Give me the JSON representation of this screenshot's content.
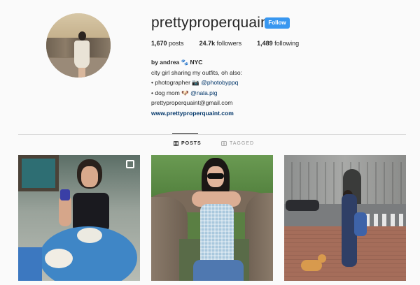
{
  "profile": {
    "username": "prettyproperquaint",
    "follow_label": "Follow",
    "stats": {
      "posts_count": "1,670",
      "posts_label": "posts",
      "followers_count": "24.7k",
      "followers_label": "followers",
      "following_count": "1,489",
      "following_label": "following"
    },
    "bio": {
      "name_line": "by andrea 🐾 NYC",
      "line1": "city girl sharing my outfits, oh also:",
      "line2_prefix": "• photographer 📷",
      "line2_handle": "@photobyppq",
      "line3_prefix": "• dog mom 🐶",
      "line3_handle": "@nala.pig",
      "email": "prettyproperquaint@gmail.com",
      "website": "www.prettyproperquaint.com"
    }
  },
  "tabs": {
    "posts_label": "POSTS",
    "tagged_label": "TAGGED"
  },
  "colors": {
    "follow_button": "#3897f0",
    "link": "#003569"
  },
  "icons": {
    "posts_tab": "grid-icon",
    "tagged_tab": "tag-icon",
    "multi_post": "carousel-icon"
  }
}
